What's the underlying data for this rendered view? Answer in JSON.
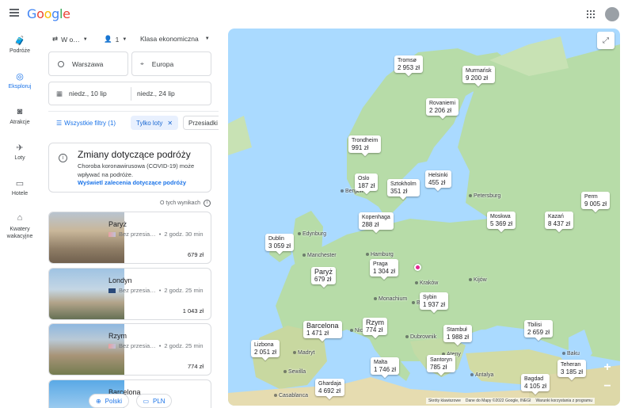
{
  "header": {
    "logo": "Google"
  },
  "nav": [
    {
      "label": "Podróże",
      "icon": "suitcase-icon"
    },
    {
      "label": "Eksploruj",
      "icon": "explore-icon",
      "active": true
    },
    {
      "label": "Atrakcje",
      "icon": "camera-icon"
    },
    {
      "label": "Loty",
      "icon": "plane-icon"
    },
    {
      "label": "Hotele",
      "icon": "bed-icon"
    },
    {
      "label": "Kwatery wakacyjne",
      "icon": "house-icon"
    }
  ],
  "search": {
    "trip_type": "W o…",
    "passengers": "1",
    "cabin": "Klasa ekonomiczna",
    "origin": "Warszawa",
    "destination": "Europa",
    "depart": "niedz., 10 lip",
    "return": "niedz., 24 lip"
  },
  "filters": {
    "all": "Wszystkie filtry (1)",
    "nonstop": "Tylko loty",
    "stops": "Przesiadki"
  },
  "covid": {
    "title": "Zmiany dotyczące podróży",
    "desc": "Choroba koronawirusowa (COVID-19) może wpływać na podróże.",
    "link": "Wyświetl zalecenia dotyczące podróży"
  },
  "about_results": "O tych wynikach",
  "results": [
    {
      "city": "Paryż",
      "stops": "Bez przesia…",
      "duration": "2 godz. 30 min",
      "price": "679 zł"
    },
    {
      "city": "Londyn",
      "stops": "Bez przesia…",
      "duration": "2 godz. 25 min",
      "price": "1 043 zł"
    },
    {
      "city": "Rzym",
      "stops": "Bez przesia…",
      "duration": "2 godz. 25 min",
      "price": "774 zł"
    },
    {
      "city": "Barcelona",
      "stops": "",
      "duration": "",
      "price": ""
    }
  ],
  "bottom": {
    "language": "Polski",
    "currency": "PLN"
  },
  "map": {
    "markers": [
      {
        "name": "Tromsø",
        "price": "2 953 zł"
      },
      {
        "name": "Murmańsk",
        "price": "9 200 zł"
      },
      {
        "name": "Rovaniemi",
        "price": "2 206 zł"
      },
      {
        "name": "Trondheim",
        "price": "991 zł"
      },
      {
        "name": "Oslo",
        "price": "187 zł"
      },
      {
        "name": "Sztokholm",
        "price": "351 zł"
      },
      {
        "name": "Helsinki",
        "price": "455 zł"
      },
      {
        "name": "Perm",
        "price": "9 005 zł"
      },
      {
        "name": "Kopenhaga",
        "price": "288 zł"
      },
      {
        "name": "Moskwa",
        "price": "5 369 zł"
      },
      {
        "name": "Kazań",
        "price": "8 437 zł"
      },
      {
        "name": "Dublin",
        "price": "3 059 zł"
      },
      {
        "name": "Paryż",
        "price": "679 zł",
        "big": true
      },
      {
        "name": "Praga",
        "price": "1 304 zł"
      },
      {
        "name": "Sybin",
        "price": "1 937 zł"
      },
      {
        "name": "Barcelona",
        "price": "1 471 zł",
        "big": true
      },
      {
        "name": "Rzym",
        "price": "774 zł",
        "big": true
      },
      {
        "name": "Stambuł",
        "price": "1 988 zł"
      },
      {
        "name": "Tbilisi",
        "price": "2 659 zł"
      },
      {
        "name": "Lizbona",
        "price": "2 051 zł"
      },
      {
        "name": "Malta",
        "price": "1 746 zł"
      },
      {
        "name": "Santoryn",
        "price": "785 zł"
      },
      {
        "name": "Teheran",
        "price": "3 185 zł"
      },
      {
        "name": "Bagdad",
        "price": "4 105 zł"
      },
      {
        "name": "Ghardaja",
        "price": "4 692 zł"
      }
    ],
    "places": [
      "Bergen",
      "Petersburg",
      "Edynburg",
      "Manchester",
      "Hamburg",
      "Kraków",
      "Kijów",
      "Monachium",
      "Bukareszt",
      "Nicea",
      "Madryt",
      "Dubrownik",
      "Ateny",
      "Sewilla",
      "Antalya",
      "Baku",
      "Casablanca"
    ],
    "attribution": [
      "Skróty klawiszowe",
      "Dane do Mapy ©2022 Google, INEGI",
      "Warunki korzystania z programu"
    ]
  }
}
